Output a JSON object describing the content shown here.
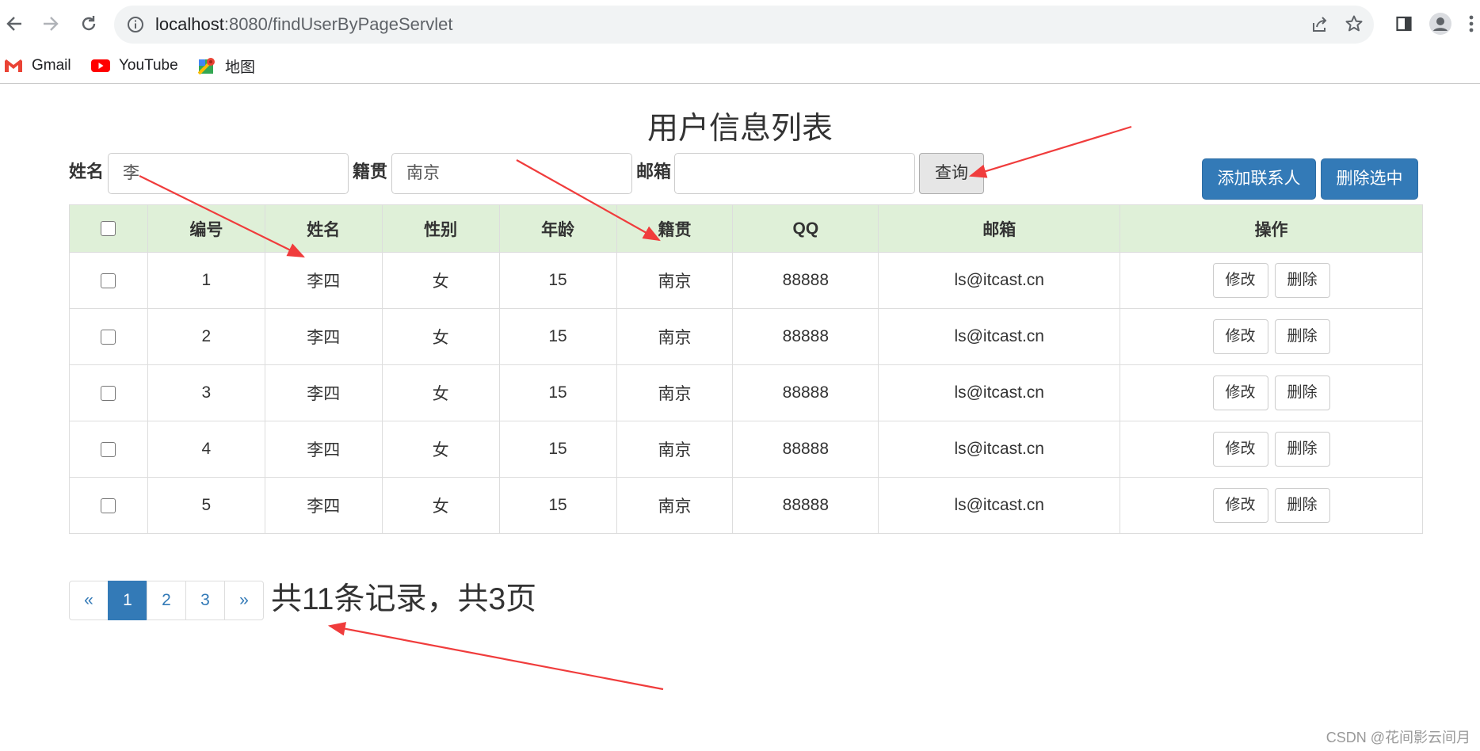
{
  "browser": {
    "url_host": "localhost",
    "url_rest": ":8080/findUserByPageServlet",
    "bookmarks": [
      {
        "label": "Gmail",
        "icon": "gmail-icon"
      },
      {
        "label": "YouTube",
        "icon": "youtube-icon"
      },
      {
        "label": "地图",
        "icon": "maps-icon"
      }
    ]
  },
  "page": {
    "title": "用户信息列表",
    "search": {
      "name_label": "姓名",
      "name_value": "李",
      "address_label": "籍贯",
      "address_value": "南京",
      "email_label": "邮箱",
      "email_value": "",
      "query_label": "查询"
    },
    "add_label": "添加联系人",
    "delete_selected_label": "删除选中"
  },
  "table": {
    "headers": [
      "",
      "编号",
      "姓名",
      "性别",
      "年龄",
      "籍贯",
      "QQ",
      "邮箱",
      "操作"
    ],
    "rows": [
      {
        "id": "1",
        "name": "李四",
        "gender": "女",
        "age": "15",
        "address": "南京",
        "qq": "88888",
        "email": "ls@itcast.cn"
      },
      {
        "id": "2",
        "name": "李四",
        "gender": "女",
        "age": "15",
        "address": "南京",
        "qq": "88888",
        "email": "ls@itcast.cn"
      },
      {
        "id": "3",
        "name": "李四",
        "gender": "女",
        "age": "15",
        "address": "南京",
        "qq": "88888",
        "email": "ls@itcast.cn"
      },
      {
        "id": "4",
        "name": "李四",
        "gender": "女",
        "age": "15",
        "address": "南京",
        "qq": "88888",
        "email": "ls@itcast.cn"
      },
      {
        "id": "5",
        "name": "李四",
        "gender": "女",
        "age": "15",
        "address": "南京",
        "qq": "88888",
        "email": "ls@itcast.cn"
      }
    ],
    "edit_label": "修改",
    "delete_label": "删除"
  },
  "pagination": {
    "prev": "«",
    "pages": [
      "1",
      "2",
      "3"
    ],
    "active_page": "1",
    "next": "»",
    "summary": "共11条记录，共3页"
  },
  "watermark": "CSDN @花间影云间月",
  "colors": {
    "primary": "#337ab7",
    "header_bg": "#dff0d8",
    "annotation_arrow": "#f03c3c"
  }
}
